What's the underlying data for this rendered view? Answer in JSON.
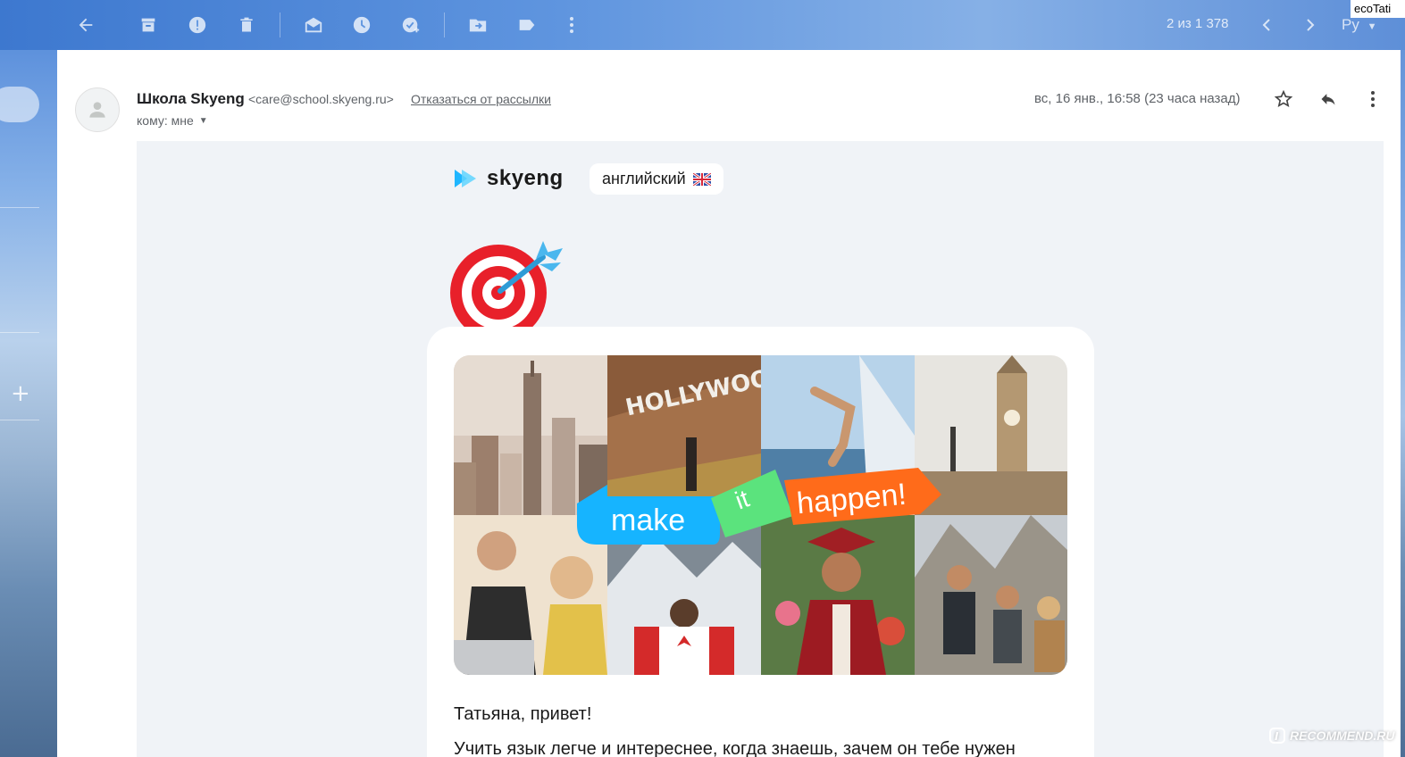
{
  "toolbar": {
    "icons": [
      "back-arrow-icon",
      "archive-icon",
      "spam-icon",
      "trash-icon",
      "mark-read-icon",
      "snooze-icon",
      "add-task-icon",
      "move-icon",
      "label-icon",
      "more-vertical-icon"
    ],
    "count_text": "2 из 1 378",
    "lang_label": "Ру"
  },
  "watermark_top": "ecoTati",
  "email": {
    "sender_name": "Школа Skyeng",
    "sender_email": "<care@school.skyeng.ru>",
    "unsubscribe": "Отказаться от рассылки",
    "to": "кому: мне",
    "date": "вс, 16 янв., 16:58 (23 часа назад)"
  },
  "body": {
    "brand": "skyeng",
    "lang_chip": "английский",
    "banner_words": [
      "make",
      "it",
      "happen!"
    ],
    "greeting": "Татьяна, привет!",
    "line1": "Учить язык легче и интереснее, когда знаешь, зачем он тебе нужен"
  },
  "watermark_bottom": "RECOMMEND.RU",
  "colors": {
    "skyeng_blue": "#1fb6ff",
    "skyeng_green": "#5be37d",
    "skyeng_orange": "#ff6b1a",
    "target_red": "#e8202a"
  }
}
